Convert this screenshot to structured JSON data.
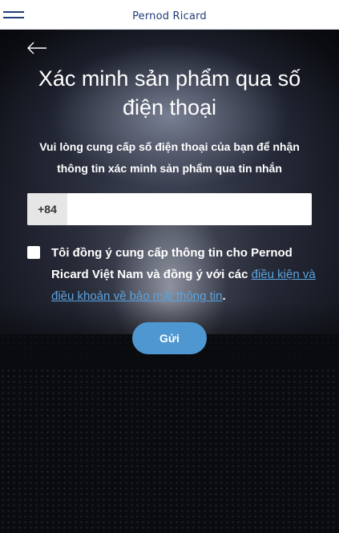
{
  "header": {
    "brand": "Pernod Ricard",
    "menu_icon": "hamburger-menu-icon"
  },
  "page": {
    "back_icon": "arrow-left-icon",
    "title": "Xác minh sản phẩm qua số điện thoại",
    "description": "Vui lòng cung cấp số điện thoại của bạn để nhận thông tin xác minh sản phẩm qua tin nhắn"
  },
  "phone": {
    "prefix": "+84",
    "value": "",
    "placeholder": ""
  },
  "consent": {
    "checked": false,
    "text": "Tôi đồng ý cung cấp thông tin cho Pernod Ricard Việt Nam và đồng ý với các ",
    "link_text": "điều kiện và điều khoản về bảo mật thông tin",
    "suffix": "."
  },
  "submit": {
    "label": "Gửi"
  },
  "colors": {
    "brand": "#1f3d7a",
    "accent": "#4e97d1",
    "link": "#5aa4e0"
  }
}
